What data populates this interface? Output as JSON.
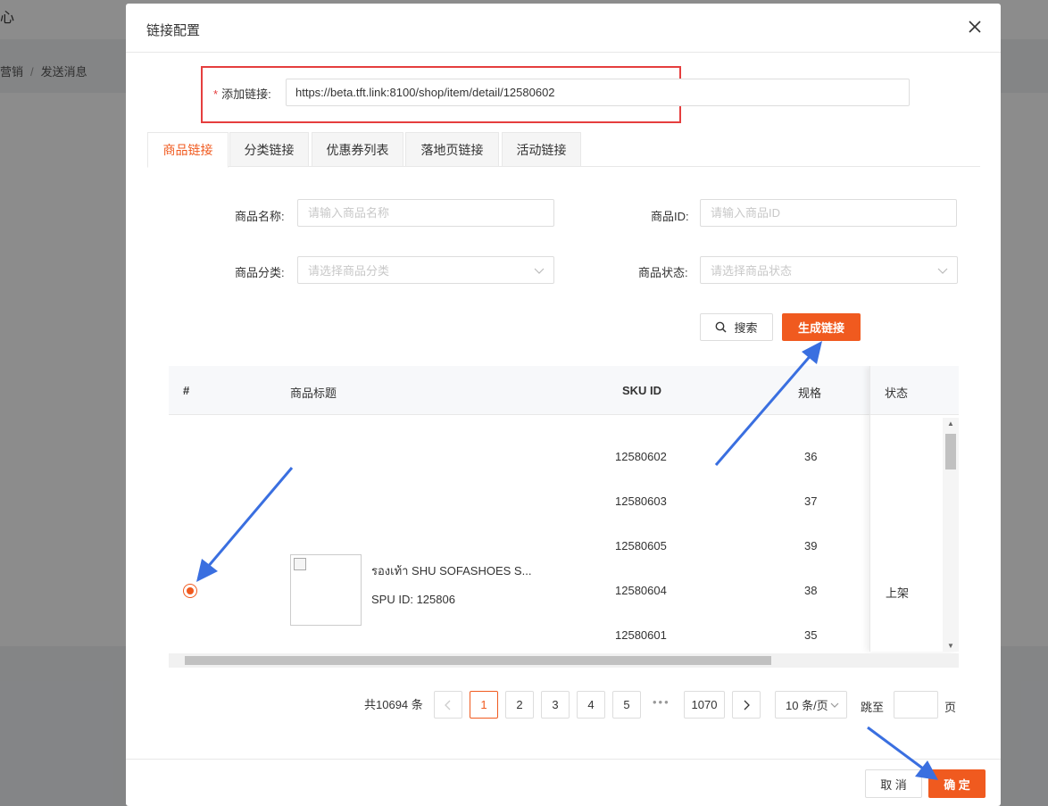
{
  "background": {
    "header_text": "心",
    "breadcrumb": [
      "营销",
      "发送消息"
    ]
  },
  "modal": {
    "title": "链接配置",
    "link_label": "添加链接:",
    "link_required_mark": "*",
    "link_value": "https://beta.tft.link:8100/shop/item/detail/12580602",
    "tabs": [
      "商品链接",
      "分类链接",
      "优惠券列表",
      "落地页链接",
      "活动链接"
    ],
    "active_tab": 0,
    "filters": {
      "name_label": "商品名称:",
      "name_placeholder": "请输入商品名称",
      "id_label": "商品ID:",
      "id_placeholder": "请输入商品ID",
      "category_label": "商品分类:",
      "category_placeholder": "请选择商品分类",
      "status_label": "商品状态:",
      "status_placeholder": "请选择商品状态"
    },
    "search_button": "搜索",
    "generate_button": "生成链接",
    "table": {
      "headers": [
        "#",
        "商品标题",
        "SKU ID",
        "规格",
        "状态"
      ],
      "product": {
        "title": "รองเท้า SHU SOFASHOES S...",
        "spu": "SPU ID: 125806",
        "status": "上架",
        "selected": true
      },
      "skus": [
        {
          "id": "12580602",
          "spec": "36"
        },
        {
          "id": "12580603",
          "spec": "37"
        },
        {
          "id": "12580605",
          "spec": "39"
        },
        {
          "id": "12580604",
          "spec": "38"
        },
        {
          "id": "12580601",
          "spec": "35"
        }
      ]
    },
    "pagination": {
      "total": "共10694 条",
      "pages": [
        "1",
        "2",
        "3",
        "4",
        "5"
      ],
      "ellipsis": "•••",
      "last_page": "1070",
      "current": "1",
      "page_size": "10 条/页",
      "jump_label": "跳至",
      "page_suffix": "页"
    },
    "cancel_button": "取 消",
    "confirm_button": "确 定"
  },
  "colors": {
    "accent": "#f05a1f",
    "highlight_box": "#e53e3e",
    "annotation_arrow": "#3a6fe0"
  }
}
